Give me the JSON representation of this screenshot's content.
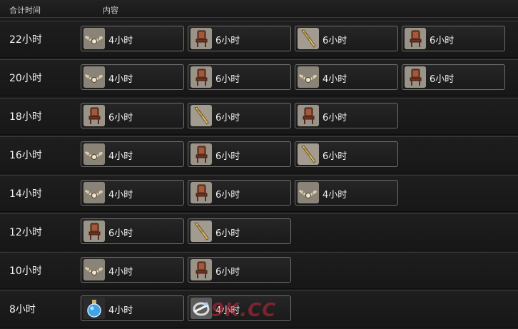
{
  "header": {
    "time_label": "合计时间",
    "content_label": "内容"
  },
  "icons": {
    "necklace": "necklace-icon",
    "chair": "chair-icon",
    "bat": "club-icon",
    "potion": "potion-icon",
    "ring": "ring-icon"
  },
  "rows": [
    {
      "time": "22小时",
      "items": [
        {
          "icon": "necklace",
          "duration": "4小时"
        },
        {
          "icon": "chair",
          "duration": "6小时"
        },
        {
          "icon": "bat",
          "duration": "6小时"
        },
        {
          "icon": "chair",
          "duration": "6小时"
        }
      ]
    },
    {
      "time": "20小时",
      "items": [
        {
          "icon": "necklace",
          "duration": "4小时"
        },
        {
          "icon": "chair",
          "duration": "6小时"
        },
        {
          "icon": "necklace",
          "duration": "4小时"
        },
        {
          "icon": "chair",
          "duration": "6小时"
        }
      ]
    },
    {
      "time": "18小时",
      "items": [
        {
          "icon": "chair",
          "duration": "6小时"
        },
        {
          "icon": "bat",
          "duration": "6小时"
        },
        {
          "icon": "chair",
          "duration": "6小时"
        }
      ]
    },
    {
      "time": "16小时",
      "items": [
        {
          "icon": "necklace",
          "duration": "4小时"
        },
        {
          "icon": "chair",
          "duration": "6小时"
        },
        {
          "icon": "bat",
          "duration": "6小时"
        }
      ]
    },
    {
      "time": "14小时",
      "items": [
        {
          "icon": "necklace",
          "duration": "4小时"
        },
        {
          "icon": "chair",
          "duration": "6小时"
        },
        {
          "icon": "necklace",
          "duration": "4小时"
        }
      ]
    },
    {
      "time": "12小时",
      "items": [
        {
          "icon": "chair",
          "duration": "6小时"
        },
        {
          "icon": "bat",
          "duration": "6小时"
        }
      ]
    },
    {
      "time": "10小时",
      "items": [
        {
          "icon": "necklace",
          "duration": "4小时"
        },
        {
          "icon": "chair",
          "duration": "6小时"
        }
      ]
    },
    {
      "time": "8小时",
      "items": [
        {
          "icon": "potion",
          "duration": "4小时"
        },
        {
          "icon": "ring",
          "duration": "4小时"
        }
      ]
    }
  ],
  "watermark": "9K.CC"
}
